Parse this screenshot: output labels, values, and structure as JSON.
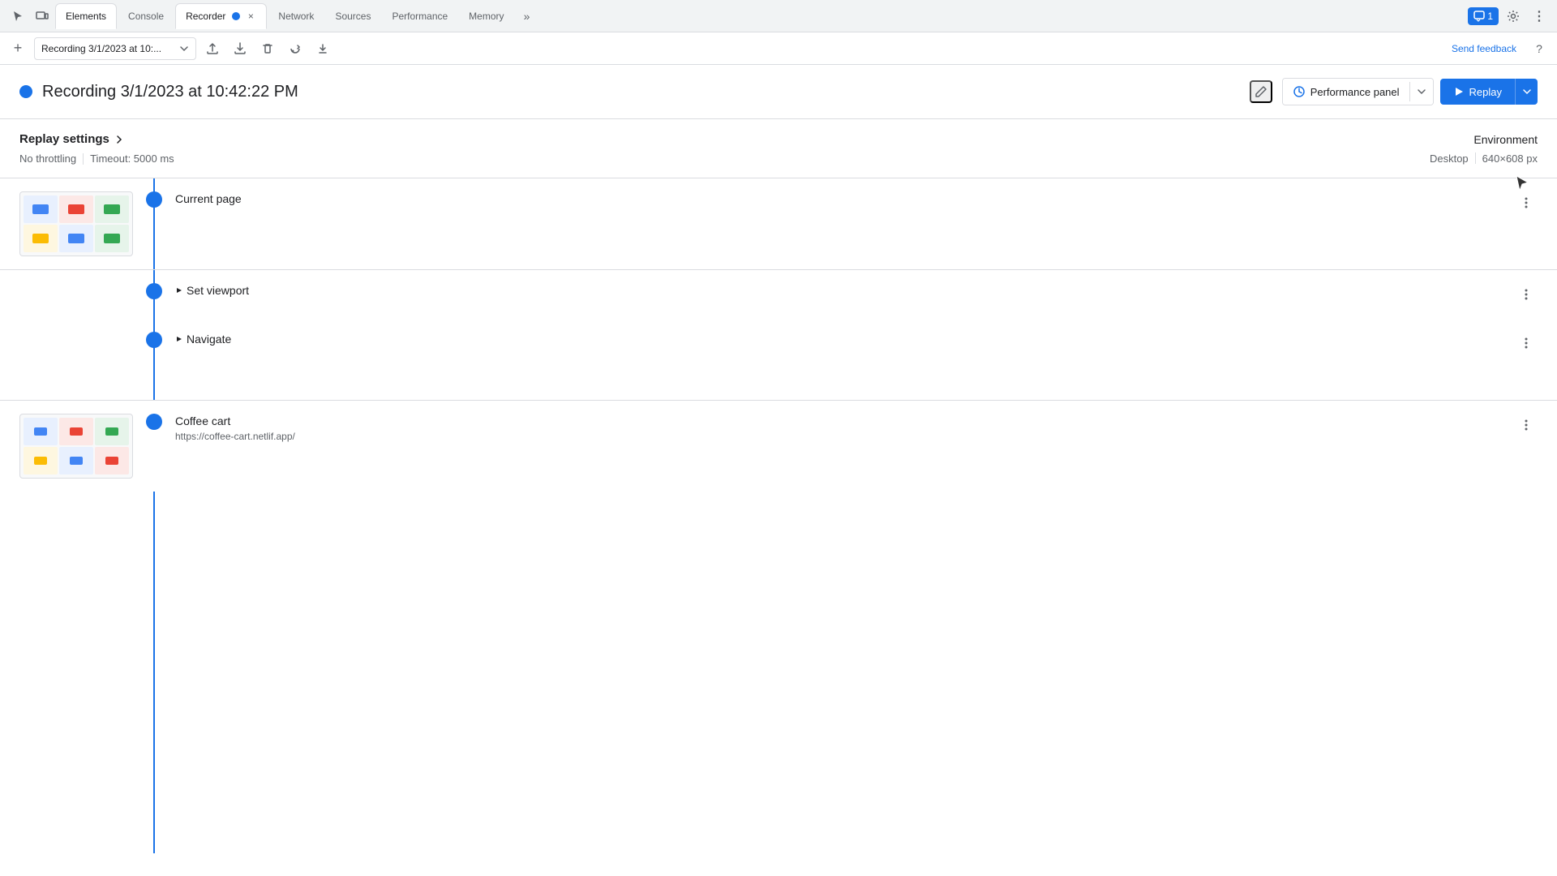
{
  "tabs": {
    "items": [
      {
        "id": "elements",
        "label": "Elements",
        "active": false
      },
      {
        "id": "console",
        "label": "Console",
        "active": false
      },
      {
        "id": "recorder",
        "label": "Recorder",
        "active": true
      },
      {
        "id": "network",
        "label": "Network",
        "active": false
      },
      {
        "id": "sources",
        "label": "Sources",
        "active": false
      },
      {
        "id": "performance",
        "label": "Performance",
        "active": false
      },
      {
        "id": "memory",
        "label": "Memory",
        "active": false
      }
    ],
    "more_label": "»",
    "notification_count": "1"
  },
  "toolbar": {
    "add_label": "+",
    "recording_name": "Recording 3/1/2023 at 10:...",
    "send_feedback_label": "Send feedback",
    "help_label": "?"
  },
  "recording": {
    "title": "Recording 3/1/2023 at 10:42:22 PM",
    "performance_panel_label": "Performance panel",
    "replay_label": "Replay"
  },
  "replay_settings": {
    "title": "Replay settings",
    "no_throttling": "No throttling",
    "timeout": "Timeout: 5000 ms",
    "environment_title": "Environment",
    "desktop": "Desktop",
    "resolution": "640×608 px"
  },
  "steps": [
    {
      "id": "current-page",
      "label": "Current page",
      "expandable": false,
      "has_thumbnail": true
    },
    {
      "id": "set-viewport",
      "label": "Set viewport",
      "expandable": true,
      "has_thumbnail": false
    },
    {
      "id": "navigate",
      "label": "Navigate",
      "expandable": true,
      "has_thumbnail": false
    }
  ],
  "coffee_cart": {
    "label": "Coffee cart",
    "url": "https://coffee-cart.netlif.app/",
    "has_thumbnail": true
  },
  "colors": {
    "blue": "#1a73e8",
    "border": "#dadce0",
    "text_secondary": "#5f6368",
    "bg_light": "#f8f9fa",
    "tab_active_bg": "#ffffff"
  },
  "icons": {
    "cursor": "↖",
    "chevron_right": "▶",
    "chevron_down": "▾",
    "three_dots": "⋮",
    "play": "▶",
    "edit": "✏",
    "upload": "↑",
    "download": "↓",
    "delete": "🗑",
    "step_into": "↷",
    "step_over": "↺",
    "add": "+",
    "expand": "▶",
    "close": "×",
    "help": "?"
  }
}
